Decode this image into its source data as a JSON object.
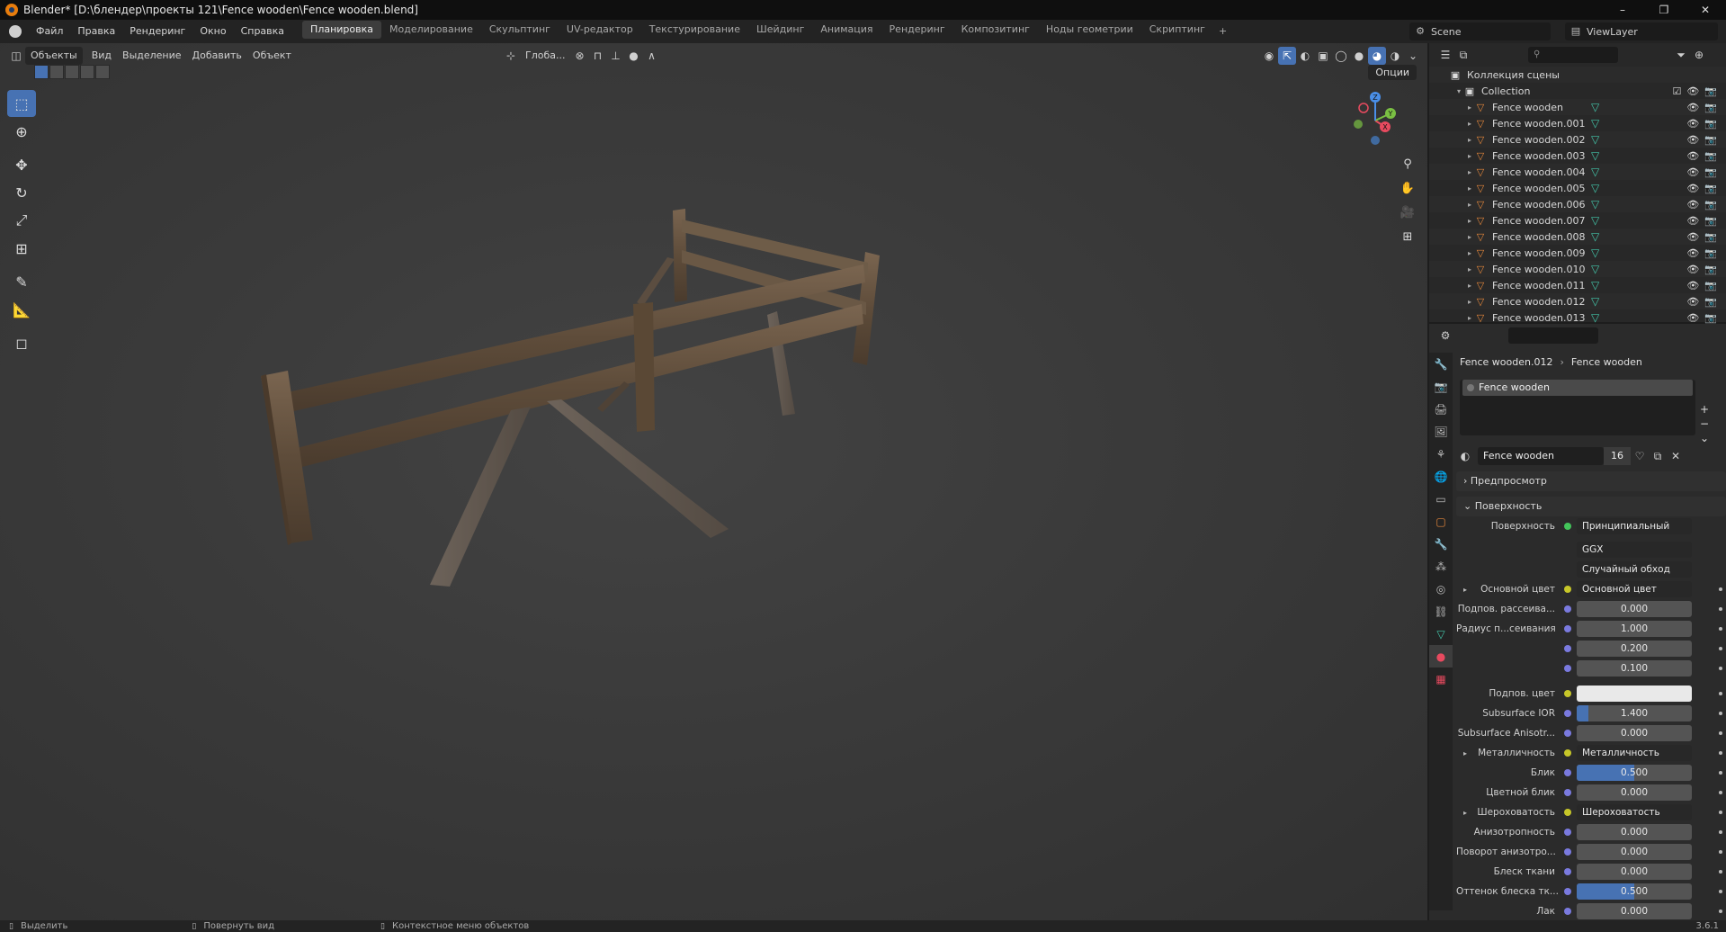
{
  "window": {
    "title": "Blender* [D:\\блендер\\проекты 121\\Fence wooden\\Fence wooden.blend]",
    "controls": [
      "–",
      "❐",
      "✕"
    ]
  },
  "menu": [
    "Файл",
    "Правка",
    "Рендеринг",
    "Окно",
    "Справка"
  ],
  "workspaces": [
    "Планировка",
    "Моделирование",
    "Скульптинг",
    "UV-редактор",
    "Текстурирование",
    "Шейдинг",
    "Анимация",
    "Рендеринг",
    "Композитинг",
    "Ноды геометрии",
    "Скриптинг"
  ],
  "active_workspace": "Планировка",
  "scene": "Scene",
  "view_layer": "ViewLayer",
  "viewport": {
    "mode": "Объекты",
    "menus": [
      "Вид",
      "Выделение",
      "Добавить",
      "Объект"
    ],
    "transform_orientation": "Глоба...",
    "options_label": "Опции",
    "gizmo_axes": [
      "X",
      "Y",
      "Z"
    ]
  },
  "outliner": {
    "scene_collection": "Коллекция сцены",
    "collection": "Collection",
    "objects": [
      "Fence wooden",
      "Fence wooden.001",
      "Fence wooden.002",
      "Fence wooden.003",
      "Fence wooden.004",
      "Fence wooden.005",
      "Fence wooden.006",
      "Fence wooden.007",
      "Fence wooden.008",
      "Fence wooden.009",
      "Fence wooden.010",
      "Fence wooden.011",
      "Fence wooden.012",
      "Fence wooden.013"
    ]
  },
  "properties": {
    "object": "Fence wooden.012",
    "material": "Fence wooden",
    "slot": "Fence wooden",
    "users": "16",
    "panels": {
      "preview": "Предпросмотр",
      "surface": "Поверхность"
    },
    "surface_shader": "Принципиальный BSDF",
    "distribution": "GGX",
    "subsurface_method": "Случайный обход",
    "rows": [
      {
        "label": "Основной цвет",
        "value": "Основной цвет",
        "kind": "link",
        "expand": true
      },
      {
        "label": "Подпов. рассеива...",
        "value": "0.000",
        "kind": "num",
        "fill": 0
      },
      {
        "label": "Радиус п...сеивания",
        "value": "1.000",
        "kind": "num",
        "fill": 0
      },
      {
        "label": "",
        "value": "0.200",
        "kind": "num",
        "fill": 0
      },
      {
        "label": "",
        "value": "0.100",
        "kind": "num",
        "fill": 0
      },
      {
        "label": "Подпов. цвет",
        "value": "",
        "kind": "color"
      },
      {
        "label": "Subsurface IOR",
        "value": "1.400",
        "kind": "num",
        "fill": 0.1
      },
      {
        "label": "Subsurface Anisotr...",
        "value": "0.000",
        "kind": "num",
        "fill": 0
      },
      {
        "label": "Металличность",
        "value": "Металличность",
        "kind": "link",
        "expand": true
      },
      {
        "label": "Блик",
        "value": "0.500",
        "kind": "num",
        "fill": 0.5
      },
      {
        "label": "Цветной блик",
        "value": "0.000",
        "kind": "num",
        "fill": 0
      },
      {
        "label": "Шероховатость",
        "value": "Шероховатость",
        "kind": "link",
        "expand": true
      },
      {
        "label": "Анизотропность",
        "value": "0.000",
        "kind": "num",
        "fill": 0
      },
      {
        "label": "Поворот анизотро...",
        "value": "0.000",
        "kind": "num",
        "fill": 0
      },
      {
        "label": "Блеск ткани",
        "value": "0.000",
        "kind": "num",
        "fill": 0
      },
      {
        "label": "Оттенок блеска тк...",
        "value": "0.500",
        "kind": "num",
        "fill": 0.5
      },
      {
        "label": "Лак",
        "value": "0.000",
        "kind": "num",
        "fill": 0
      }
    ]
  },
  "status": {
    "select": "Выделить",
    "rotate": "Повернуть вид",
    "context": "Контекстное меню объектов",
    "version": "3.6.1"
  },
  "colors": {
    "accent": "#4772b3",
    "mesh_icon": "#e5873b",
    "data_icon": "#43c5a9",
    "wood": "#5e4c3a"
  }
}
